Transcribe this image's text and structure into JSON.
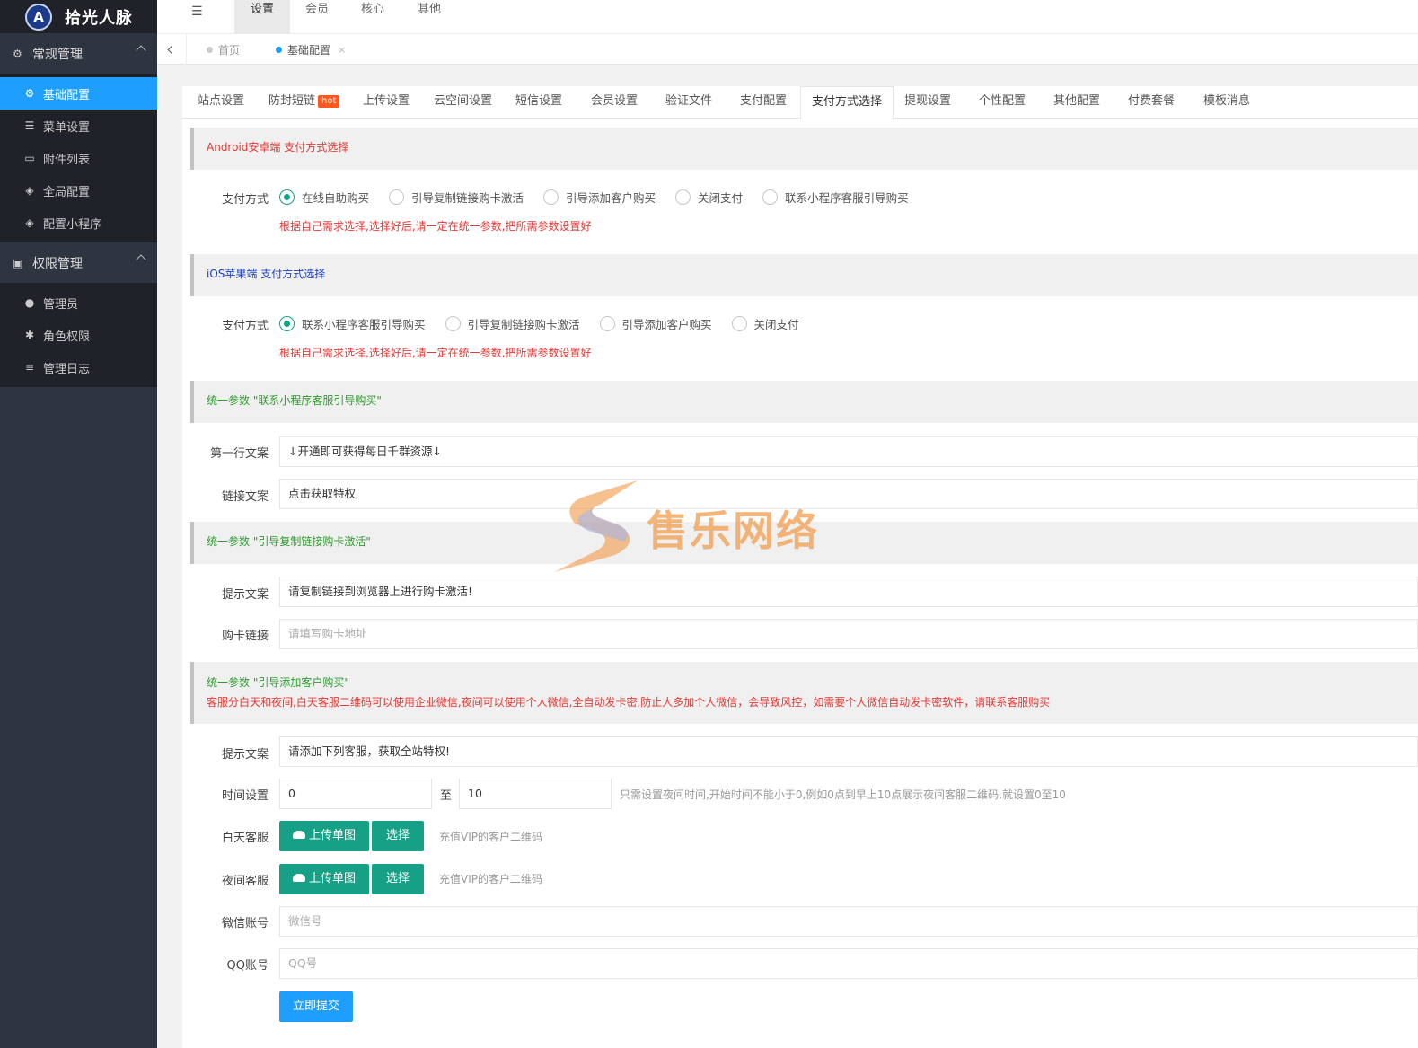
{
  "brand": {
    "name": "拾光人脉",
    "logo_letter": "A"
  },
  "sidebar": {
    "groups": [
      {
        "label": "常规管理",
        "icon": "gear-icon",
        "items": [
          {
            "label": "基础配置",
            "icon": "gear-icon",
            "active": true
          },
          {
            "label": "菜单设置",
            "icon": "menu-icon"
          },
          {
            "label": "附件列表",
            "icon": "folder-icon"
          },
          {
            "label": "全局配置",
            "icon": "cube-icon"
          },
          {
            "label": "配置小程序",
            "icon": "cube-icon"
          }
        ]
      },
      {
        "label": "权限管理",
        "icon": "bus-icon",
        "items": [
          {
            "label": "管理员",
            "icon": "user-circle-icon"
          },
          {
            "label": "角色权限",
            "icon": "bug-icon"
          },
          {
            "label": "管理日志",
            "icon": "list-icon"
          }
        ]
      }
    ]
  },
  "topbar": {
    "tabs": [
      "设置",
      "会员",
      "核心",
      "其他"
    ],
    "active": 0
  },
  "pagetabs": {
    "home": "首页",
    "current": "基础配置",
    "close": "×"
  },
  "config_tabs": {
    "items": [
      "站点设置",
      "防封短链",
      "上传设置",
      "云空间设置",
      "短信设置",
      "会员设置",
      "验证文件",
      "支付配置",
      "支付方式选择",
      "提现设置",
      "个性配置",
      "其他配置",
      "付费套餐",
      "模板消息"
    ],
    "hot_badge": "hot",
    "active": 8
  },
  "android": {
    "title": "Android安卓端 支付方式选择",
    "label": "支付方式",
    "options": [
      "在线自助购买",
      "引导复制链接购卡激活",
      "引导添加客户购买",
      "关闭支付",
      "联系小程序客服引导购买"
    ],
    "selected": 0,
    "hint": "根据自己需求选择,选择好后,请一定在统一参数,把所需参数设置好"
  },
  "ios": {
    "title": "iOS苹果端 支付方式选择",
    "label": "支付方式",
    "options": [
      "联系小程序客服引导购买",
      "引导复制链接购卡激活",
      "引导添加客户购买",
      "关闭支付"
    ],
    "selected": 0,
    "hint": "根据自己需求选择,选择好后,请一定在统一参数,把所需参数设置好"
  },
  "miniapp_params": {
    "title": "统一参数 \"联系小程序客服引导购买\"",
    "line1_label": "第一行文案",
    "line1_value": "↓开通即可获得每日千群资源↓",
    "link_label": "链接文案",
    "link_value": "点击获取特权"
  },
  "copy_params": {
    "title": "统一参数 \"引导复制链接购卡激活\"",
    "tip_label": "提示文案",
    "tip_value": "请复制链接到浏览器上进行购卡激活!",
    "card_label": "购卡链接",
    "card_placeholder": "请填写购卡地址"
  },
  "customer_params": {
    "title": "统一参数 \"引导添加客户购买\"",
    "note": "客服分白天和夜间,白天客服二维码可以使用企业微信,夜间可以使用个人微信,全自动发卡密,防止人多加个人微信，会导致风控，如需要个人微信自动发卡密软件，请联系客服购买",
    "tip_label": "提示文案",
    "tip_value": "请添加下列客服，获取全站特权!",
    "time_label": "时间设置",
    "time_from": "0",
    "time_to_sep": "至",
    "time_to": "10",
    "time_note": "只需设置夜间时间,开始时间不能小于0,例如0点到早上10点展示夜间客服二维码,就设置0至10",
    "day_label": "白天客服",
    "night_label": "夜间客服",
    "upload_label": "上传单图",
    "choose_label": "选择",
    "qr_note": "充值VIP的客户二维码",
    "wechat_label": "微信账号",
    "wechat_placeholder": "微信号",
    "qq_label": "QQ账号",
    "qq_placeholder": "QQ号",
    "submit": "立即提交"
  },
  "watermark": {
    "text": "售乐网络"
  },
  "colors": {
    "accent": "#1e9fff",
    "primary_btn": "#16a085",
    "sidebar": "#2f3441",
    "danger": "#e53935"
  }
}
